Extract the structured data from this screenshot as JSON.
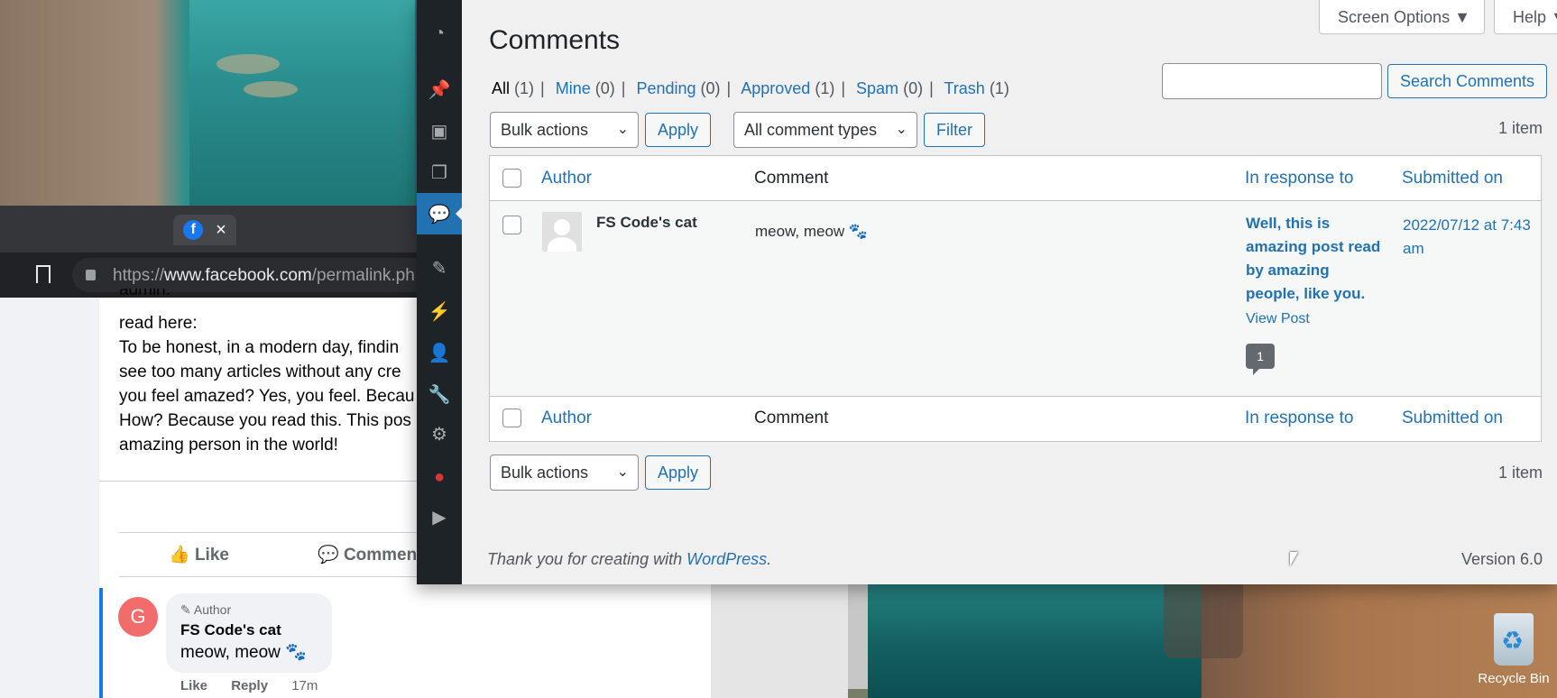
{
  "browser": {
    "url_prefix": "https://",
    "url_domain": "www.facebook.com",
    "url_path": "/permalink.ph",
    "tab_close": "×"
  },
  "facebook": {
    "post_text": [
      "admin.",
      "read here:",
      "To be honest, in a modern day, findin",
      "see too many articles without any cre",
      "you feel amazed? Yes, you feel. Becau",
      "How? Because you read this. This pos",
      "amazing person in the world!"
    ],
    "like_label": "Like",
    "comment_label": "Commen",
    "comment": {
      "avatar_letter": "G",
      "badge": "Author",
      "name": "FS Code's cat",
      "message": "meow, meow 🐾",
      "like": "Like",
      "reply": "Reply",
      "time": "17m"
    }
  },
  "desktop": {
    "recycle_label": "Recycle Bin"
  },
  "wp": {
    "screen_options": "Screen Options ▼",
    "help": "Help ▼",
    "title": "Comments",
    "filters": [
      {
        "label": "All",
        "count": "(1)"
      },
      {
        "label": "Mine",
        "count": "(0)"
      },
      {
        "label": "Pending",
        "count": "(0)"
      },
      {
        "label": "Approved",
        "count": "(1)"
      },
      {
        "label": "Spam",
        "count": "(0)"
      },
      {
        "label": "Trash",
        "count": "(1)"
      }
    ],
    "search_button": "Search Comments",
    "bulk_actions": "Bulk actions",
    "apply": "Apply",
    "comment_types": "All comment types",
    "filter": "Filter",
    "items_count": "1 item",
    "columns": {
      "author": "Author",
      "comment": "Comment",
      "in_response_to": "In response to",
      "submitted_on": "Submitted on"
    },
    "row": {
      "author": "FS Code's cat",
      "comment": "meow, meow 🐾",
      "response_title": "Well, this is amazing post read by amazing people, like you.",
      "view_post": "View Post",
      "comment_count": "1",
      "date": "2022/07/12 at 7:43 am"
    },
    "footer_text": "Thank you for creating with ",
    "footer_link": "WordPress",
    "footer_end": ".",
    "version": "Version 6.0"
  },
  "icons": [
    "dashboard-icon",
    "pin-icon",
    "media-icon",
    "pages-icon",
    "comments-icon",
    "appearance-icon",
    "plugins-icon",
    "users-icon",
    "tools-icon",
    "settings-icon",
    "plugin-bulb-icon",
    "play-icon"
  ]
}
